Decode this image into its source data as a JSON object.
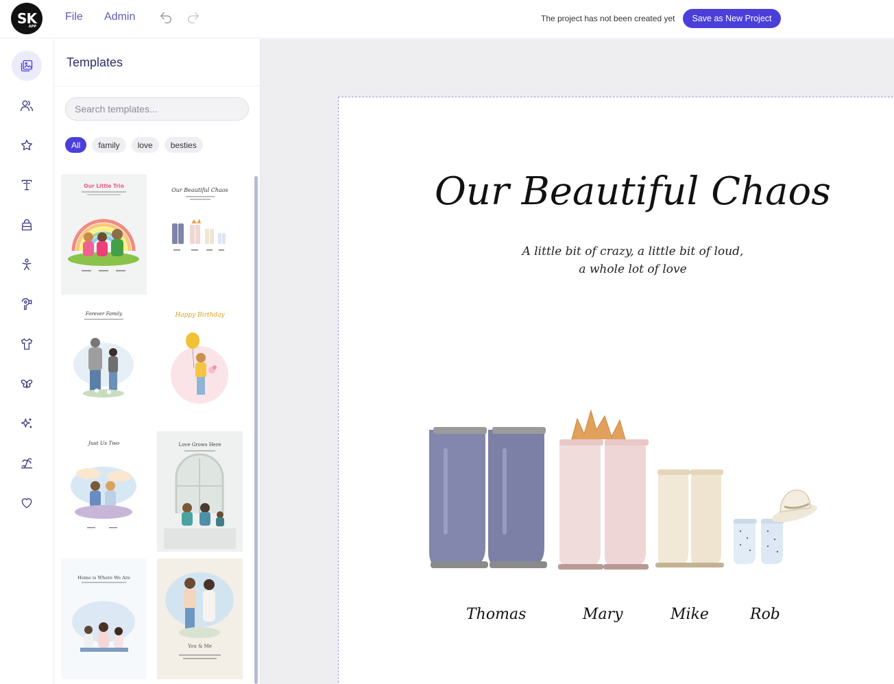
{
  "app": {
    "logo_text": "SK",
    "logo_sub": "APP",
    "menu": {
      "file": "File",
      "admin": "Admin"
    },
    "status_text": "The project has not been created yet",
    "save_button": "Save as New Project"
  },
  "rail": {
    "items": [
      {
        "name": "templates",
        "icon": "image-icon",
        "active": true
      },
      {
        "name": "people",
        "icon": "users-icon",
        "active": false
      },
      {
        "name": "favorites",
        "icon": "star-icon",
        "active": false
      },
      {
        "name": "text",
        "icon": "text-icon",
        "active": false
      },
      {
        "name": "accessories",
        "icon": "bag-icon",
        "active": false
      },
      {
        "name": "characters",
        "icon": "figure-icon",
        "active": false
      },
      {
        "name": "hairstyles",
        "icon": "hairdryer-icon",
        "active": false
      },
      {
        "name": "clothing",
        "icon": "shirt-icon",
        "active": false
      },
      {
        "name": "decorations",
        "icon": "butterfly-icon",
        "active": false
      },
      {
        "name": "effects",
        "icon": "sparkle-icon",
        "active": false
      },
      {
        "name": "backgrounds",
        "icon": "palm-icon",
        "active": false
      },
      {
        "name": "love",
        "icon": "heart-icon",
        "active": false
      }
    ]
  },
  "panel": {
    "title": "Templates",
    "search_placeholder": "Search templates...",
    "filters": [
      {
        "label": "All",
        "active": true
      },
      {
        "label": "family",
        "active": false
      },
      {
        "label": "love",
        "active": false
      },
      {
        "label": "besties",
        "active": false
      }
    ],
    "templates": [
      {
        "caption": "Our Little Trio"
      },
      {
        "caption": "Our Beautiful Chaos"
      },
      {
        "caption": "Forever Family"
      },
      {
        "caption": "Happy Birthday"
      },
      {
        "caption": "Just Us Two"
      },
      {
        "caption": "Love Grows Here"
      },
      {
        "caption": "Home is Where We Are"
      },
      {
        "caption": "You & Me"
      }
    ]
  },
  "canvas": {
    "title": "Our Beautiful Chaos",
    "subtitle_line1": "A little bit of crazy, a little bit of loud,",
    "subtitle_line2": "a whole lot of love",
    "names": [
      "Thomas",
      "Mary",
      "Mike",
      "Rob"
    ]
  },
  "colors": {
    "accent": "#4a3fd9",
    "menu_text": "#5b5bb8",
    "canvas_bg": "#eeeef1"
  }
}
